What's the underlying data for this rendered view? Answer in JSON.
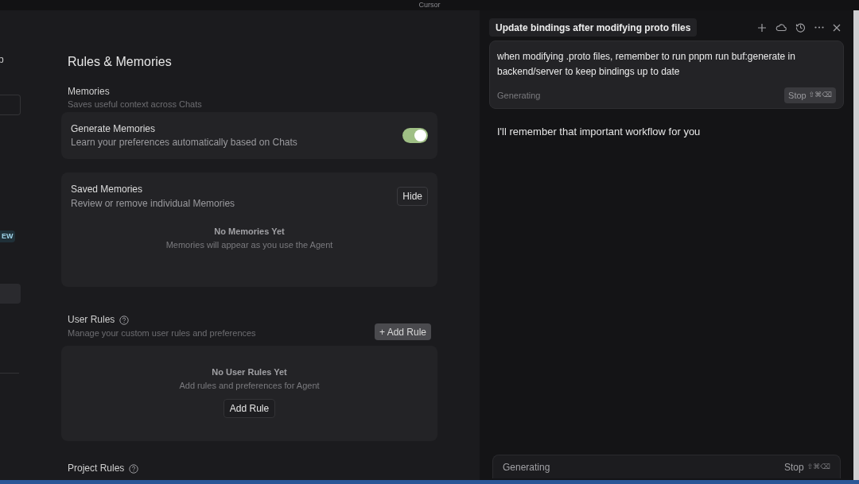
{
  "window": {
    "title": "Cursor"
  },
  "sidebar": {
    "fragment_text": "p",
    "badge": "EW"
  },
  "settings": {
    "title": "Rules & Memories",
    "memories": {
      "title": "Memories",
      "subtitle": "Saves useful context across Chats"
    },
    "generate": {
      "title": "Generate Memories",
      "subtitle": "Learn your preferences automatically based on Chats",
      "on": true
    },
    "saved": {
      "title": "Saved Memories",
      "subtitle": "Review or remove individual Memories",
      "button": "Hide",
      "empty_title": "No Memories Yet",
      "empty_text": "Memories will appear as you use the Agent"
    },
    "user_rules": {
      "title": "User Rules",
      "subtitle": "Manage your custom user rules and preferences",
      "add_button": "+ Add Rule",
      "empty_title": "No User Rules Yet",
      "empty_text": "Add rules and preferences for Agent",
      "empty_button": "Add Rule"
    },
    "project_rules": {
      "title": "Project Rules"
    }
  },
  "chat": {
    "tab_title": "Update bindings after modifying proto files",
    "prompt": "when modifying .proto files, remember to run pnpm run buf:generate in backend/server to keep bindings up to date",
    "prompt_status": "Generating",
    "prompt_stop": "Stop",
    "prompt_shortcut": "⇧⌘⌫",
    "reply": "I'll remember that important workflow for you",
    "footer_status": "Generating",
    "footer_stop": "Stop",
    "footer_shortcut": "⇧⌘⌫"
  }
}
